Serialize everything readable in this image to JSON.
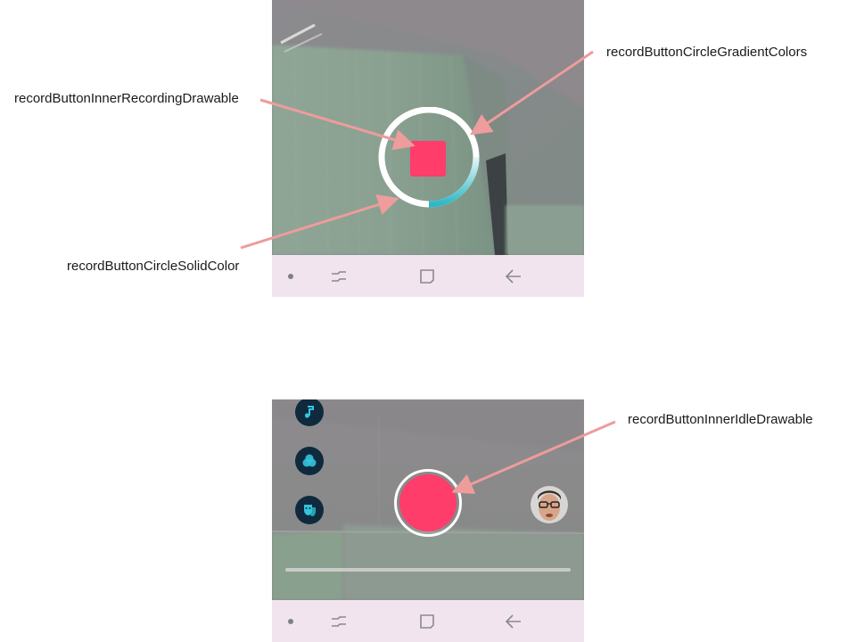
{
  "annotations": {
    "gradient_colors": "recordButtonCircleGradientColors",
    "inner_recording_drawable": "recordButtonInnerRecordingDrawable",
    "circle_solid_color": "recordButtonCircleSolidColor",
    "inner_idle_drawable": "recordButtonInnerIdleDrawable"
  },
  "colors": {
    "record_accent": "#ff3d6b",
    "gradient_start": "#2bb9c6",
    "gradient_end": "#e9f6f8",
    "solid_ring": "#ffffff",
    "arrow": "#ee9c9c",
    "navbar": "#f1e4ef",
    "side_icon_bg": "#0f2a3d",
    "side_icon_fg": "#35c4dc"
  },
  "recording_screen": {
    "recording_progress": 0.25,
    "navbar_icons": [
      "dot-icon",
      "recents-icon",
      "home-icon",
      "back-icon"
    ]
  },
  "idle_screen": {
    "side_icons": [
      "music-note-icon",
      "filter-icon",
      "mask-icon"
    ],
    "clip_progress": 0,
    "navbar_icons": [
      "dot-icon",
      "recents-icon",
      "home-icon",
      "back-icon"
    ]
  }
}
